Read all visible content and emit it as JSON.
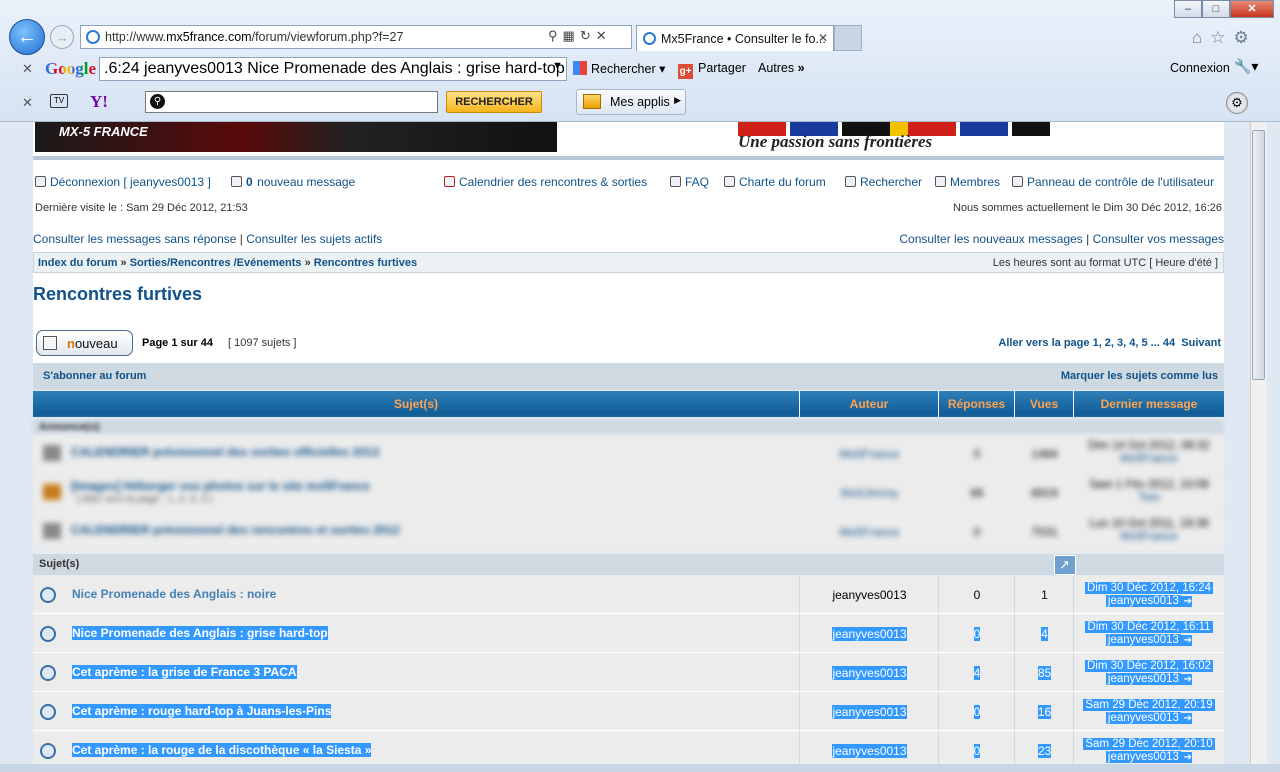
{
  "browser": {
    "url_prefix": "http://www.",
    "url_domain": "mx5france.com",
    "url_path": "/forum/viewforum.php?f=27",
    "tab_title": "Mx5France • Consulter le fo...",
    "window_controls": [
      "–",
      "□",
      "✕"
    ]
  },
  "google_bar": {
    "logo": "Google",
    "search_value": ".6:24 jeanyves0013 Nice Promenade des Anglais : grise hard-top",
    "rechercher": "Rechercher",
    "partager": "Partager",
    "autres": "Autres",
    "connexion": "Connexion"
  },
  "yahoo_bar": {
    "button": "RECHERCHER",
    "mes_applis": "Mes applis"
  },
  "banner": {
    "slogan": "Une passion sans frontières",
    "logo_text": "MX-5 FRANCE"
  },
  "userbar": {
    "logout": "Déconnexion [ jeanyves0013 ]",
    "new_msg_count": "0",
    "new_msg_label": "nouveau message",
    "calendar": "Calendrier des rencontres & sorties",
    "faq": "FAQ",
    "charte": "Charte du forum",
    "search": "Rechercher",
    "members": "Membres",
    "panel": "Panneau de contrôle de l'utilisateur"
  },
  "visit": {
    "last": "Dernière visite le : Sam 29 Déc 2012, 21:53",
    "now": "Nous sommes actuellement le Dim 30 Déc 2012, 16:26"
  },
  "quicklinks": {
    "unanswered": "Consulter les messages sans réponse",
    "active": "Consulter les sujets actifs",
    "new": "Consulter les nouveaux messages",
    "yours": "Consulter vos messages",
    "sep": "|"
  },
  "breadcrumb": {
    "index": "Index du forum",
    "cat": "Sorties/Rencontres /Evénements",
    "forum": "Rencontres furtives",
    "sep": "»",
    "tz": "Les heures sont au format UTC [ Heure d'été ]"
  },
  "title": "Rencontres furtives",
  "pagination": {
    "new_button_n": "n",
    "new_button_rest": "ouveau",
    "page_info": "Page 1 sur 44",
    "topics": "[ 1097 sujets ]",
    "goto": "Aller vers la page",
    "pages": "1, 2, 3, 4, 5 ... 44",
    "next": "Suivant"
  },
  "subbar": {
    "subscribe": "S'abonner au forum",
    "mark": "Marquer les sujets comme lus"
  },
  "table_headers": {
    "subject": "Sujet(s)",
    "author": "Auteur",
    "replies": "Réponses",
    "views": "Vues",
    "last": "Dernier message"
  },
  "announcements_label": "Annonce(s)",
  "announcements": [
    {
      "title": "CALENDRIER prévisionnel des sorties officielles 2013",
      "author": "Mx5France",
      "replies": "0",
      "views": "1484",
      "last_date": "Dim 14 Oct 2012, 09:32",
      "last_author": "Mx5France"
    },
    {
      "title": "[Images] Héberger vos photos sur le site mx5France",
      "sub": "[ Aller vers la page : 1, 2, 3, 4 ]",
      "author": "Mx5Jimmy",
      "replies": "66",
      "views": "8919",
      "last_date": "Sam 1 Fév 2012, 10:08",
      "last_author": "Tom"
    },
    {
      "title": "CALENDRIER prévisionnel des rencontres et sorties 2012",
      "author": "Mx5France",
      "replies": "0",
      "views": "7531",
      "last_date": "Lun 10 Oct 2011, 19:38",
      "last_author": "Mx5France"
    }
  ],
  "topics_label": "Sujet(s)",
  "topics": [
    {
      "title": "Nice Promenade des Anglais : noire",
      "author": "jeanyves0013",
      "replies": "0",
      "views": "1",
      "last_date": "Dim 30 Déc 2012, 16:24",
      "last_author": "jeanyves0013",
      "selected": false
    },
    {
      "title": "Nice Promenade des Anglais : grise hard-top",
      "author": "jeanyves0013",
      "replies": "0",
      "views": "4",
      "last_date": "Dim 30 Déc 2012, 16:11",
      "last_author": "jeanyves0013",
      "selected": true
    },
    {
      "title": "Cet aprème : la grise de France 3 PACA",
      "author": "jeanyves0013",
      "replies": "4",
      "views": "85",
      "last_date": "Dim 30 Déc 2012, 16:02",
      "last_author": "jeanyves0013",
      "selected": true
    },
    {
      "title": "Cet aprème : rouge hard-top à Juans-les-Pins",
      "author": "jeanyves0013",
      "replies": "0",
      "views": "16",
      "last_date": "Sam 29 Déc 2012, 20:19",
      "last_author": "jeanyves0013",
      "selected": true
    },
    {
      "title": "Cet aprème : la rouge de la discothèque « la Siesta »",
      "author": "jeanyves0013",
      "replies": "0",
      "views": "23",
      "last_date": "Sam 29 Déc 2012, 20:10",
      "last_author": "jeanyves0013",
      "selected": true
    }
  ]
}
